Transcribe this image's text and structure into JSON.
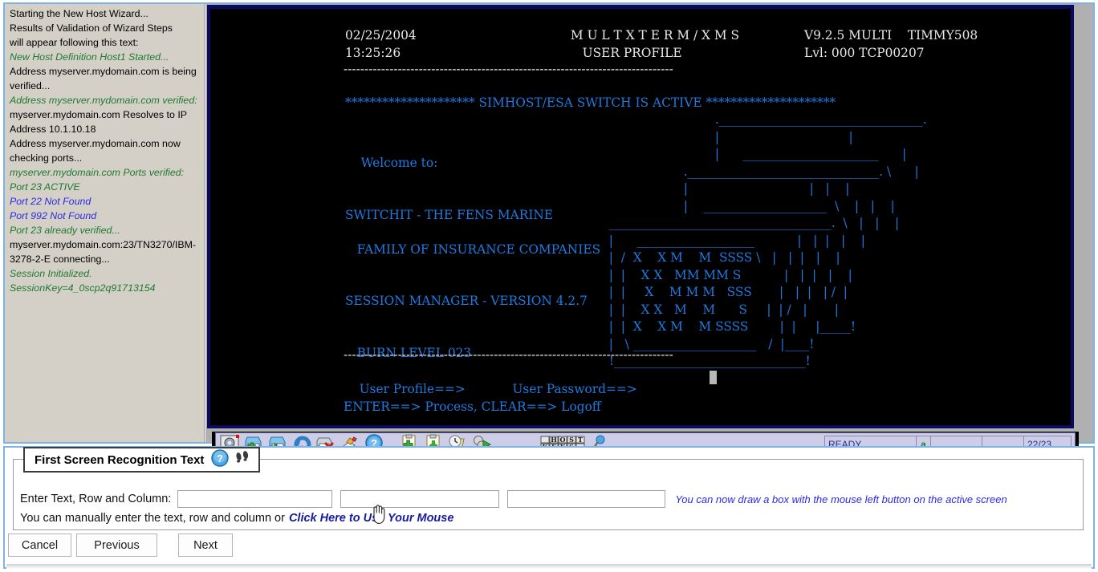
{
  "log_panel": {
    "lines": [
      {
        "text": "Starting the New Host Wizard...",
        "style": "plain"
      },
      {
        "text": "Results of Validation of Wizard Steps",
        "style": "plain"
      },
      {
        "text": "will appear following this text:",
        "style": "plain"
      },
      {
        "text": "New Host Definition Host1 Started...",
        "style": "green"
      },
      {
        "text": "Address myserver.mydomain.com is being",
        "style": "plain"
      },
      {
        "text": "verified...",
        "style": "plain"
      },
      {
        "text": "Address myserver.mydomain.com verified:",
        "style": "green"
      },
      {
        "text": "myserver.mydomain.com Resolves to IP",
        "style": "plain"
      },
      {
        "text": "Address 10.1.10.18",
        "style": "plain"
      },
      {
        "text": "Address myserver.mydomain.com now",
        "style": "plain"
      },
      {
        "text": "checking ports...",
        "style": "plain"
      },
      {
        "text": "myserver.mydomain.com Ports verified:",
        "style": "green"
      },
      {
        "text": "Port 23 ACTIVE",
        "style": "green"
      },
      {
        "text": "Port 22 Not Found",
        "style": "blue"
      },
      {
        "text": "Port 992 Not Found",
        "style": "blue"
      },
      {
        "text": "Port 23 already verified...",
        "style": "green"
      },
      {
        "text": "myserver.mydomain.com:23/TN3270/IBM-",
        "style": "plain"
      },
      {
        "text": "3278-2-E connecting...",
        "style": "plain"
      },
      {
        "text": "Session Initialized.",
        "style": "green"
      },
      {
        "text": "SessionKey=4_0scp2q91713154",
        "style": "green"
      }
    ]
  },
  "terminal": {
    "header_left": "02/25/2004\n13:25:26",
    "header_mid": "          M U L T X T E R M / X M S\n             USER PROFILE",
    "header_right": "V9.2.5 MULTI    TIMMY508\nLvl: 000 TCP00207",
    "date": "02/25/2004",
    "time": "13:25:26",
    "product": "M U L T X T E R M / X M S",
    "version": "V9.2.5 MULTI",
    "user": "TIMMY508",
    "screen_title": "USER PROFILE",
    "level": "Lvl: 000",
    "session_id": "TCP00207",
    "rule": "-------------------------------------------------------------------------------",
    "banner": "********************* SIMHOST/ESA SWITCH IS ACTIVE *********************",
    "left_block": "\n\n    Welcome to:\n\n\nSWITCHIT - THE FENS MARINE\n\n   FAMILY OF INSURANCE COMPANIES\n\n\nSESSION MANAGER - VERSION 4.2.7\n\n\n   BURN LEVEL 023",
    "welcome": "Welcome to:",
    "company_line1": "SWITCHIT - THE FENS MARINE",
    "company_line2": "FAMILY OF INSURANCE COMPANIES",
    "session_manager": "SESSION MANAGER - VERSION 4.2.7",
    "burn_level": "BURN LEVEL 023",
    "ascii_art": "                             ._________________________________.\n                             |                                 |\n                             |      ______________________      |\n                     ._______________________________. \\      |\n                     |                               |   |    |\n                     |    ____________________  \\    |   |    |\n  ____________________________________.  \\   |   |    |\n  |      ___________________           |   |  |   |    |\n  |  /  X    X M    M  SSSS \\   |   |  |   |    |\n  |  |    X X   MM MM S           |   |  |   |    |\n  |  |     X    M M M   SSS       |   |  |   | /  |\n  |  |    X X   M    M      S     |  | /   |       |\n  |  |  X    X M    M SSSS        |  |     |_____!\n  |   \\ ____________________   /  |____!\n  !_______________________________!",
    "prompt_line": "    User Profile==>            User Password==>",
    "user_profile_label": "User Profile==>",
    "user_password_label": "User Password==>",
    "enter_line": "ENTER==> Process, CLEAR==> Logoff",
    "toolbar_icons": [
      "settings-gear-icon",
      "print-add-icon",
      "print-icon",
      "refresh-icon",
      "print-delete-icon",
      "edit-pencil-icon",
      "help-question-icon",
      "clipboard-add-icon",
      "clipboard-paste-icon",
      "history-clock-icon",
      "macro-run-icon",
      "host-keys-icon",
      "magnifier-icon"
    ],
    "status": {
      "ready": "READY",
      "indicator": "a",
      "blank1": "",
      "blank2": "",
      "position": "22/23"
    }
  },
  "wizard": {
    "legend_title": "First Screen Recognition Text",
    "help_icon": "help-question-icon",
    "feet_icon": "footprints-icon",
    "field_label": "Enter Text, Row and Column:",
    "text_value": "",
    "row_value": "",
    "column_value": "",
    "text_placeholder": "",
    "row_placeholder": "",
    "column_placeholder": "",
    "blue_hint": "You can now draw a box with the mouse left button on the active screen",
    "hint_text": "You can manually enter the text, row and column or",
    "hint_link": "Click Here to Use Your Mouse",
    "buttons": {
      "cancel": "Cancel",
      "previous": "Previous",
      "next": "Next"
    }
  },
  "colors": {
    "accent_border": "#7fb2e5",
    "terminal_bg": "#000000",
    "terminal_blue": "#1f7ae0",
    "terminal_white": "#e8e8e8",
    "log_green": "#1f7a2e",
    "log_blue": "#2b2be0",
    "link_blue": "#1a1a9c",
    "hint_blue": "#2a2ae8",
    "status_text": "#2b2b8f",
    "status_indicator": "#0d8030"
  }
}
